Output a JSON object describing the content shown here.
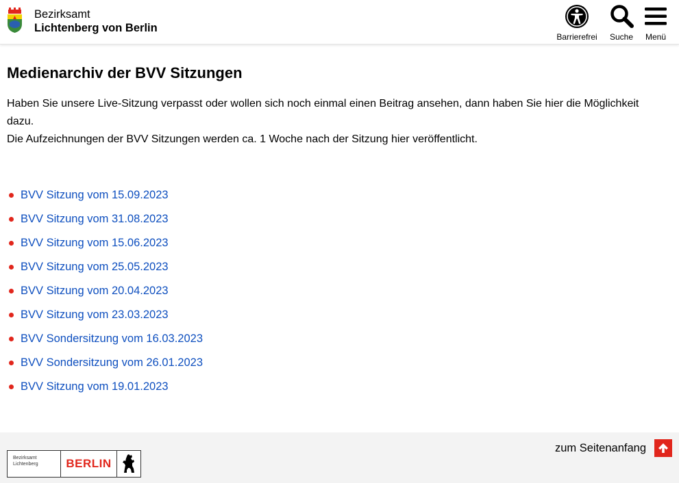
{
  "header": {
    "district_line1": "Bezirksamt",
    "district_line2": "Lichtenberg von Berlin",
    "buttons": {
      "accessibility": "Barrierefrei",
      "search": "Suche",
      "menu": "Menü"
    }
  },
  "main": {
    "title": "Medienarchiv der BVV Sitzungen",
    "intro_line1": "Haben Sie unsere Live-Sitzung verpasst oder wollen sich noch einmal einen Beitrag ansehen, dann haben Sie hier die Möglichkeit dazu.",
    "intro_line2": "Die Aufzeichnungen der BVV Sitzungen werden ca. 1 Woche nach der Sitzung hier veröffentlicht.",
    "links": [
      "BVV Sitzung vom 15.09.2023",
      "BVV Sitzung vom 31.08.2023",
      "BVV Sitzung vom 15.06.2023",
      "BVV Sitzung vom 25.05.2023",
      "BVV Sitzung vom 20.04.2023",
      "BVV Sitzung vom 23.03.2023",
      "BVV Sondersitzung vom 16.03.2023",
      "BVV Sondersitzung vom 26.01.2023",
      "BVV Sitzung vom 19.01.2023"
    ]
  },
  "footer": {
    "to_top": "zum Seitenanfang",
    "logo_line1": "Bezirksamt",
    "logo_line2": "Lichtenberg",
    "logo_city": "BERLIN"
  },
  "colors": {
    "accent_red": "#e1261c",
    "link_blue": "#0e4fbf",
    "footer_bg": "#f3f3f3"
  },
  "icons": [
    "crest-icon",
    "accessibility-icon",
    "search-icon",
    "menu-icon",
    "arrow-up-icon",
    "berlin-bear-icon"
  ]
}
